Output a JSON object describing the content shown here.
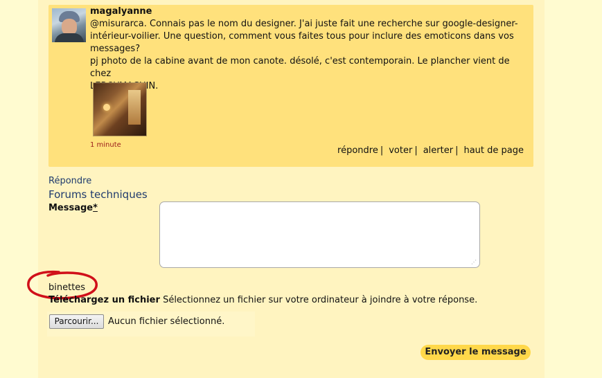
{
  "post": {
    "author": "magalyanne",
    "lines": [
      "@misurarca. Connais pas le nom du designer. J'ai juste fait une recherche sur google-designer-",
      "intérieur-voilier. Une question, comment vous faites tous pour inclure des emoticons dans vos",
      "messages?",
      "pj photo de la cabine avant de mon canote. désolé, c'est contemporain. Le plancher vient de chez",
      "LEROYMACHIN."
    ],
    "time": "1 minute",
    "actions": {
      "reply": "répondre",
      "vote": "voter",
      "alert": "alerter",
      "top": "haut de page",
      "separator": "|"
    }
  },
  "form": {
    "reply_heading": "Répondre",
    "forum_name": "Forums techniques",
    "message_label": "Message",
    "required_mark": "*",
    "message_value": "",
    "emoticons_label": "binettes",
    "upload_label": "Téléchargez un fichier",
    "upload_hint": "Sélectionnez un fichier sur votre ordinateur à joindre à votre réponse.",
    "browse_button": "Parcourir...",
    "no_file": "Aucun fichier sélectionné.",
    "submit_button": "Envoyer le message"
  },
  "colors": {
    "post_bg": "#ffe17c",
    "page_bg": "#fff4c0",
    "link": "#1f3b6d",
    "time": "#9a1a1a",
    "submit_bg": "#ffd84a",
    "annotation": "#d0101a"
  }
}
